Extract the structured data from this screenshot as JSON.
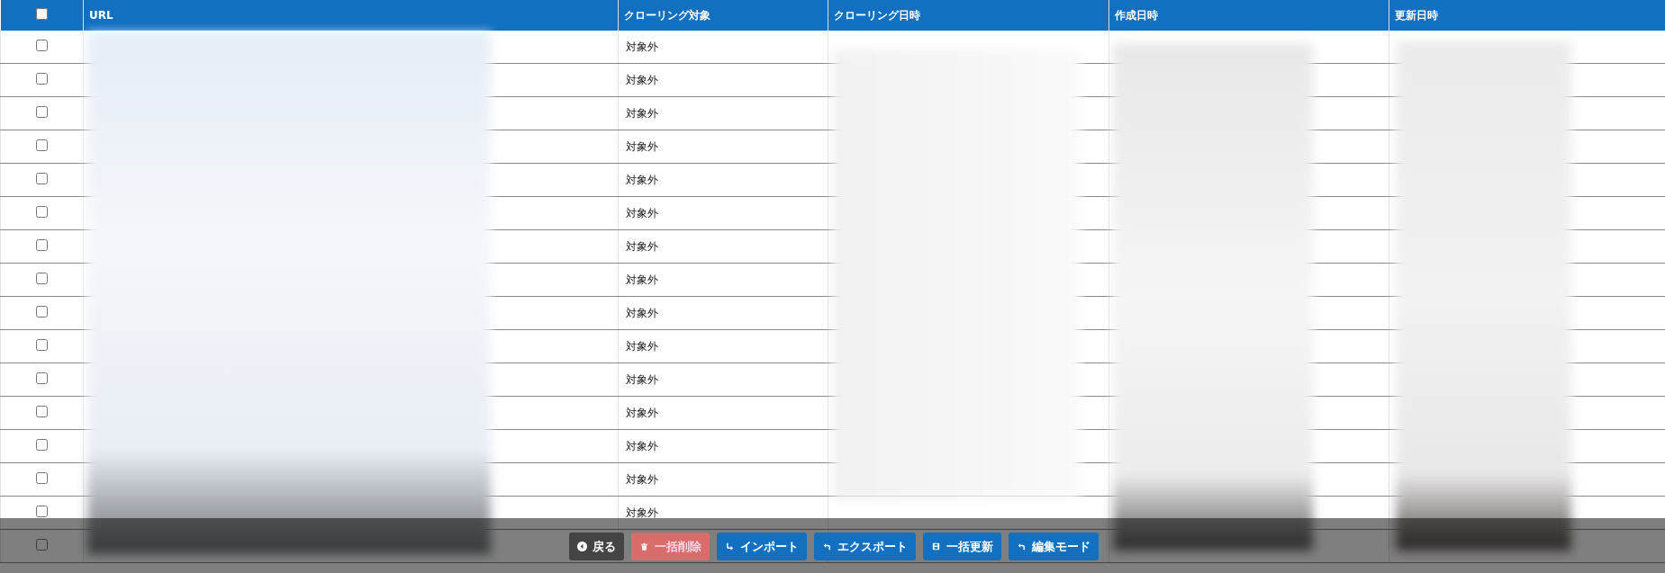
{
  "table": {
    "select_all": {
      "checked": false
    },
    "columns": [
      "URL",
      "クローリング対象",
      "クローリング日時",
      "作成日時",
      "更新日時"
    ],
    "rows": [
      {
        "checked": false,
        "crawl_target": "対象外"
      },
      {
        "checked": false,
        "crawl_target": "対象外"
      },
      {
        "checked": false,
        "crawl_target": "対象外"
      },
      {
        "checked": false,
        "crawl_target": "対象外"
      },
      {
        "checked": false,
        "crawl_target": "対象外"
      },
      {
        "checked": false,
        "crawl_target": "対象外"
      },
      {
        "checked": false,
        "crawl_target": "対象外"
      },
      {
        "checked": false,
        "crawl_target": "対象外"
      },
      {
        "checked": false,
        "crawl_target": "対象外"
      },
      {
        "checked": false,
        "crawl_target": "対象外"
      },
      {
        "checked": false,
        "crawl_target": "対象外"
      },
      {
        "checked": false,
        "crawl_target": "対象外"
      },
      {
        "checked": false,
        "crawl_target": "対象外"
      },
      {
        "checked": false,
        "crawl_target": "対象外"
      },
      {
        "checked": false,
        "crawl_target": "対象外"
      },
      {
        "checked": false
      }
    ]
  },
  "toolbar": [
    {
      "kind": "back",
      "label": "戻る"
    },
    {
      "kind": "delete",
      "label": "一括削除",
      "disabled": true
    },
    {
      "kind": "import",
      "label": "インポート"
    },
    {
      "kind": "export",
      "label": "エクスポート"
    },
    {
      "kind": "update",
      "label": "一括更新"
    },
    {
      "kind": "edit",
      "label": "編集モード"
    }
  ]
}
